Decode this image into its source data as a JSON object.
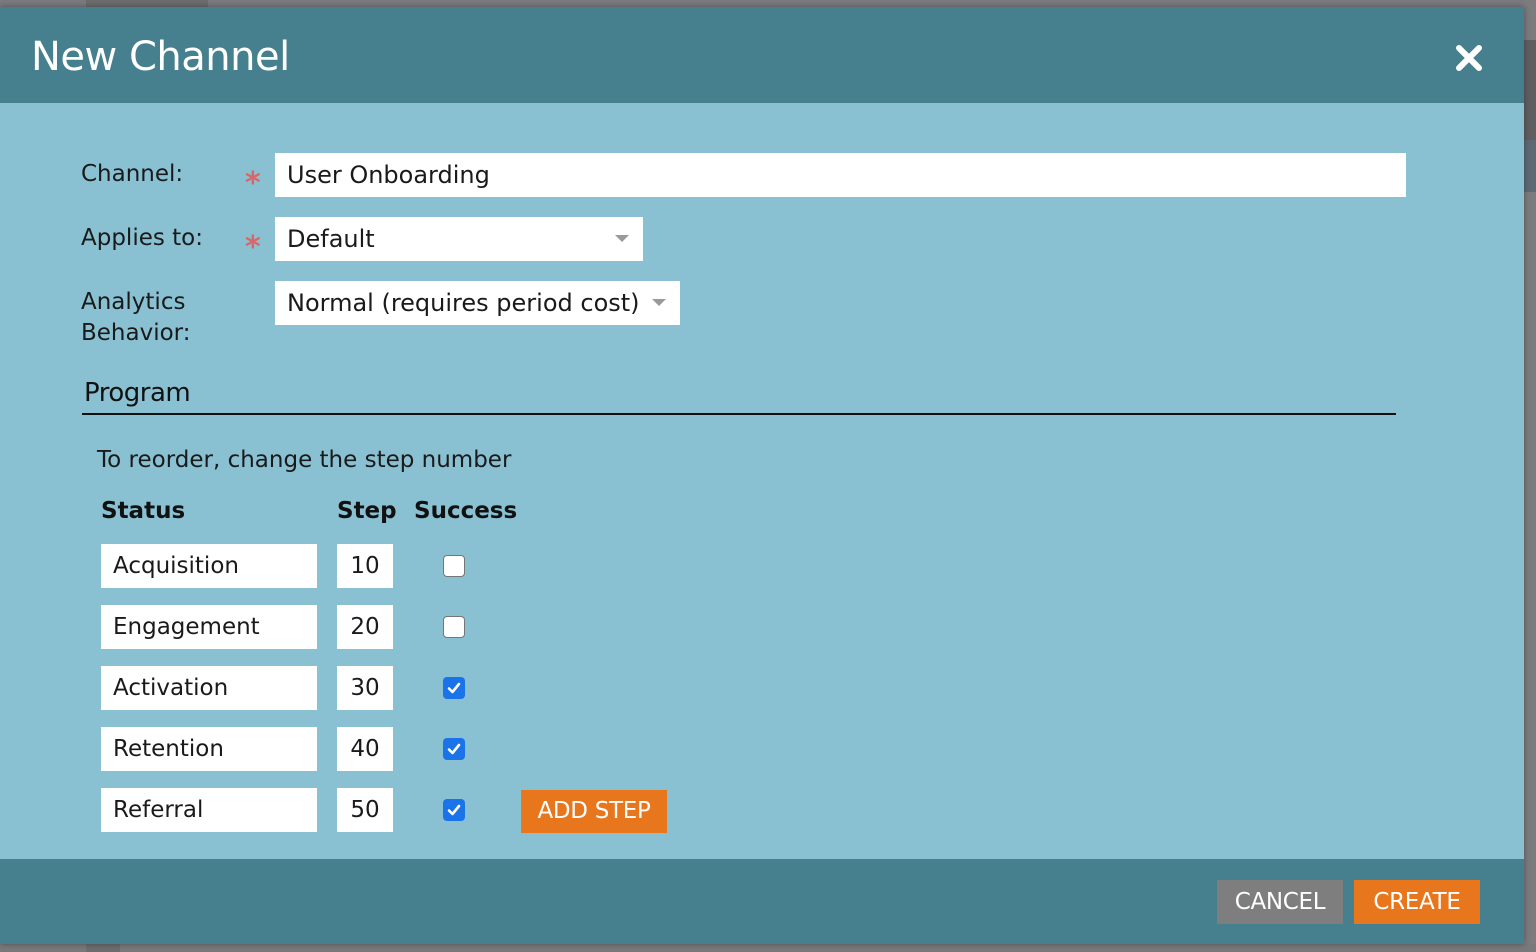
{
  "dialog": {
    "title": "New Channel",
    "close_icon": "close-icon"
  },
  "form": {
    "channel": {
      "label": "Channel:",
      "required": true,
      "value": "User Onboarding"
    },
    "applies_to": {
      "label": "Applies to:",
      "required": true,
      "value": "Default"
    },
    "analytics_behavior": {
      "label_line1": "Analytics",
      "label_line2": "Behavior:",
      "required": false,
      "value": "Normal (requires period cost)"
    },
    "required_marker": "*"
  },
  "program": {
    "section_title": "Program",
    "hint": "To reorder, change the step number",
    "columns": {
      "status": "Status",
      "step": "Step",
      "success": "Success"
    },
    "rows": [
      {
        "status": "Acquisition",
        "step": "10",
        "success": false
      },
      {
        "status": "Engagement",
        "step": "20",
        "success": false
      },
      {
        "status": "Activation",
        "step": "30",
        "success": true
      },
      {
        "status": "Retention",
        "step": "40",
        "success": true
      },
      {
        "status": "Referral",
        "step": "50",
        "success": true
      }
    ],
    "add_step_label": "ADD STEP"
  },
  "footer": {
    "cancel_label": "CANCEL",
    "create_label": "CREATE"
  },
  "colors": {
    "header": "#46808f",
    "body": "#89c1d3",
    "accent_orange": "#e8761c",
    "cancel_grey": "#7e7e7e",
    "required_red": "#d9666a",
    "checkbox_blue": "#1a73e8"
  }
}
